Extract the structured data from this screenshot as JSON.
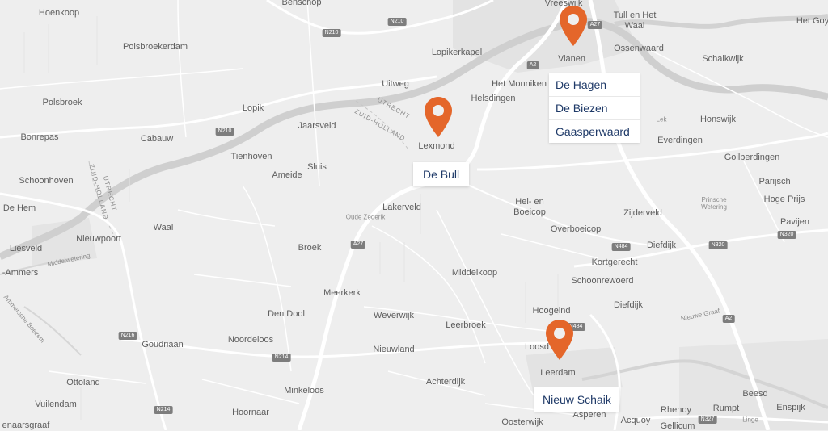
{
  "map": {
    "places": [
      "Hoenkoop",
      "Benschop",
      "Vreeswijk",
      "Tull en Het Waal",
      "Het Goy",
      "Polsbroekerdam",
      "Lopikerkapel",
      "Vianen",
      "Ossenwaard",
      "Schalkwijk",
      "Polsbroek",
      "Uitweg",
      "Het Monniken",
      "Helsdingen",
      "Lopik",
      "Jaarsveld",
      "Cabauw",
      "Honswijk",
      "Bonrepas",
      "Tienhoven",
      "Lexmond",
      "Everdingen",
      "Goilberdingen",
      "Schoonhoven",
      "Ameide",
      "Sluis",
      "Parijsch",
      "Hoge Prijs",
      "De Hem",
      "Waal",
      "Lakerveld",
      "Hei- en Boeicop",
      "Zijderveld",
      "Pavijen",
      "Liesveld",
      "Nieuwpoort",
      "Overboeicop",
      "Diefdijk",
      "Broek",
      "Kortgerecht",
      "-Ammers",
      "Middelkoop",
      "Schoonrewoerd",
      "Meerkerk",
      "Hoogeind",
      "Diefdijk",
      "Den Dool",
      "Weverwijk",
      "Leerbroek",
      "Goudriaan",
      "Noordeloos",
      "Nieuwland",
      "Loosd",
      "Ottoland",
      "Achterdijk",
      "Leerdam",
      "Beesd",
      "Vuilendam",
      "Minkeloos",
      "Rhenoy",
      "Rumpt",
      "Enspijk",
      "Hoornaar",
      "Asperen",
      "Acquoy",
      "Gellicum",
      "Oosterwijk",
      "enaarsgraaf"
    ],
    "small_labels": [
      "Lek",
      "Oude Zederik",
      "Middelwetering",
      "Prinsche Wetering",
      "Nieuwe Graaf",
      "Ammersche Boezem",
      "Linge"
    ],
    "region_labels": [
      "UTRECHT",
      "ZUID-HOLLAND",
      "UTRECHT",
      "ZUID-HOLLAND"
    ],
    "road_shields": [
      "N210",
      "N210",
      "A27",
      "A2",
      "N210",
      "A27",
      "N484",
      "N320",
      "N320",
      "N484",
      "N216",
      "N214",
      "N214",
      "A2",
      "N327"
    ]
  },
  "markers": [
    {
      "id": "vianen",
      "color": "#e4662a",
      "labels": [
        "De Hagen",
        "De Biezen",
        "Gaasperwaard"
      ]
    },
    {
      "id": "lexmond",
      "color": "#e4662a",
      "labels": [
        "De Bull"
      ]
    },
    {
      "id": "leerdam",
      "color": "#e4662a",
      "labels": [
        "Nieuw Schaik"
      ]
    }
  ]
}
